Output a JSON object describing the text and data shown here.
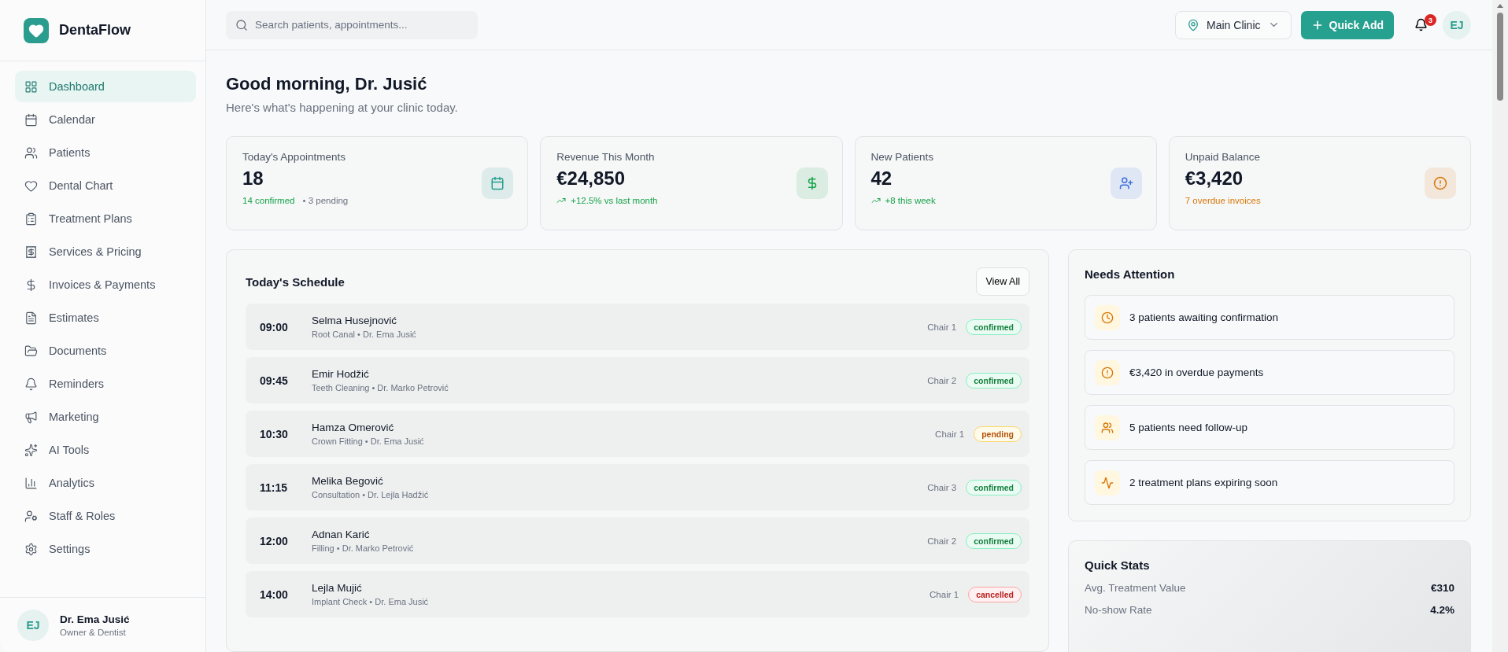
{
  "brand": {
    "name": "DentaFlow"
  },
  "sidebar": {
    "items": [
      {
        "label": "Dashboard",
        "selected": true
      },
      {
        "label": "Calendar",
        "selected": false
      },
      {
        "label": "Patients",
        "selected": false
      },
      {
        "label": "Dental Chart",
        "selected": false
      },
      {
        "label": "Treatment Plans",
        "selected": false
      },
      {
        "label": "Services & Pricing",
        "selected": false
      },
      {
        "label": "Invoices & Payments",
        "selected": false
      },
      {
        "label": "Estimates",
        "selected": false
      },
      {
        "label": "Documents",
        "selected": false
      },
      {
        "label": "Reminders",
        "selected": false
      },
      {
        "label": "Marketing",
        "selected": false
      },
      {
        "label": "AI Tools",
        "selected": false
      },
      {
        "label": "Analytics",
        "selected": false
      },
      {
        "label": "Staff & Roles",
        "selected": false
      },
      {
        "label": "Settings",
        "selected": false
      }
    ],
    "user": {
      "initials": "EJ",
      "name": "Dr. Ema Jusić",
      "role": "Owner & Dentist"
    }
  },
  "header": {
    "search": {
      "placeholder": "Search patients, appointments..."
    },
    "location": "Main Clinic",
    "quick_add": "Quick Add",
    "notifications": "3",
    "avatar": "EJ"
  },
  "greeting": {
    "title": "Good morning, Dr. Jusić",
    "subtitle": "Here's what's happening at your clinic today."
  },
  "stats": [
    {
      "label": "Today's Appointments",
      "value": "18",
      "note": "14 confirmed",
      "kind": "positive",
      "extra": "• 3 pending",
      "color": "#2a9d8f"
    },
    {
      "label": "Revenue This Month",
      "value": "€24,850",
      "note": "+12.5% vs last month",
      "kind": "trend",
      "color": "#16a34a"
    },
    {
      "label": "New Patients",
      "value": "42",
      "note": "+8 this week",
      "kind": "trend",
      "color": "#3b6fe0"
    },
    {
      "label": "Unpaid Balance",
      "value": "€3,420",
      "note": "7 overdue invoices",
      "kind": "warning",
      "color": "#d97706"
    }
  ],
  "schedule": {
    "title": "Today's Schedule",
    "view_all": "View All",
    "rows": [
      {
        "time": "09:00",
        "patient": "Selma Husejnović",
        "details": "Root Canal • Dr. Ema Jusić",
        "chair": "Chair 1",
        "status": {
          "label": "confirmed",
          "kind": "confirmed"
        }
      },
      {
        "time": "09:45",
        "patient": "Emir Hodžić",
        "details": "Teeth Cleaning • Dr. Marko Petrović",
        "chair": "Chair 2",
        "status": {
          "label": "confirmed",
          "kind": "confirmed"
        }
      },
      {
        "time": "10:30",
        "patient": "Hamza Omerović",
        "details": "Crown Fitting • Dr. Ema Jusić",
        "chair": "Chair 1",
        "status": {
          "label": "pending",
          "kind": "pending"
        }
      },
      {
        "time": "11:15",
        "patient": "Melika Begović",
        "details": "Consultation • Dr. Lejla Hadžić",
        "chair": "Chair 3",
        "status": {
          "label": "confirmed",
          "kind": "confirmed"
        }
      },
      {
        "time": "12:00",
        "patient": "Adnan Karić",
        "details": "Filling • Dr. Marko Petrović",
        "chair": "Chair 2",
        "status": {
          "label": "confirmed",
          "kind": "confirmed"
        }
      },
      {
        "time": "14:00",
        "patient": "Lejla Mujić",
        "details": "Implant Check • Dr. Ema Jusić",
        "chair": "Chair 1",
        "status": {
          "label": "cancelled",
          "kind": "cancelled"
        }
      }
    ]
  },
  "attention": {
    "title": "Needs Attention",
    "items": [
      {
        "text": "3 patients awaiting confirmation"
      },
      {
        "text": "€3,420 in overdue payments"
      },
      {
        "text": "5 patients need follow-up"
      },
      {
        "text": "2 treatment plans expiring soon"
      }
    ]
  },
  "quick_stats": {
    "title": "Quick Stats",
    "rows": [
      {
        "label": "Avg. Treatment Value",
        "value": "€310"
      },
      {
        "label": "No-show Rate",
        "value": "4.2%"
      }
    ]
  }
}
